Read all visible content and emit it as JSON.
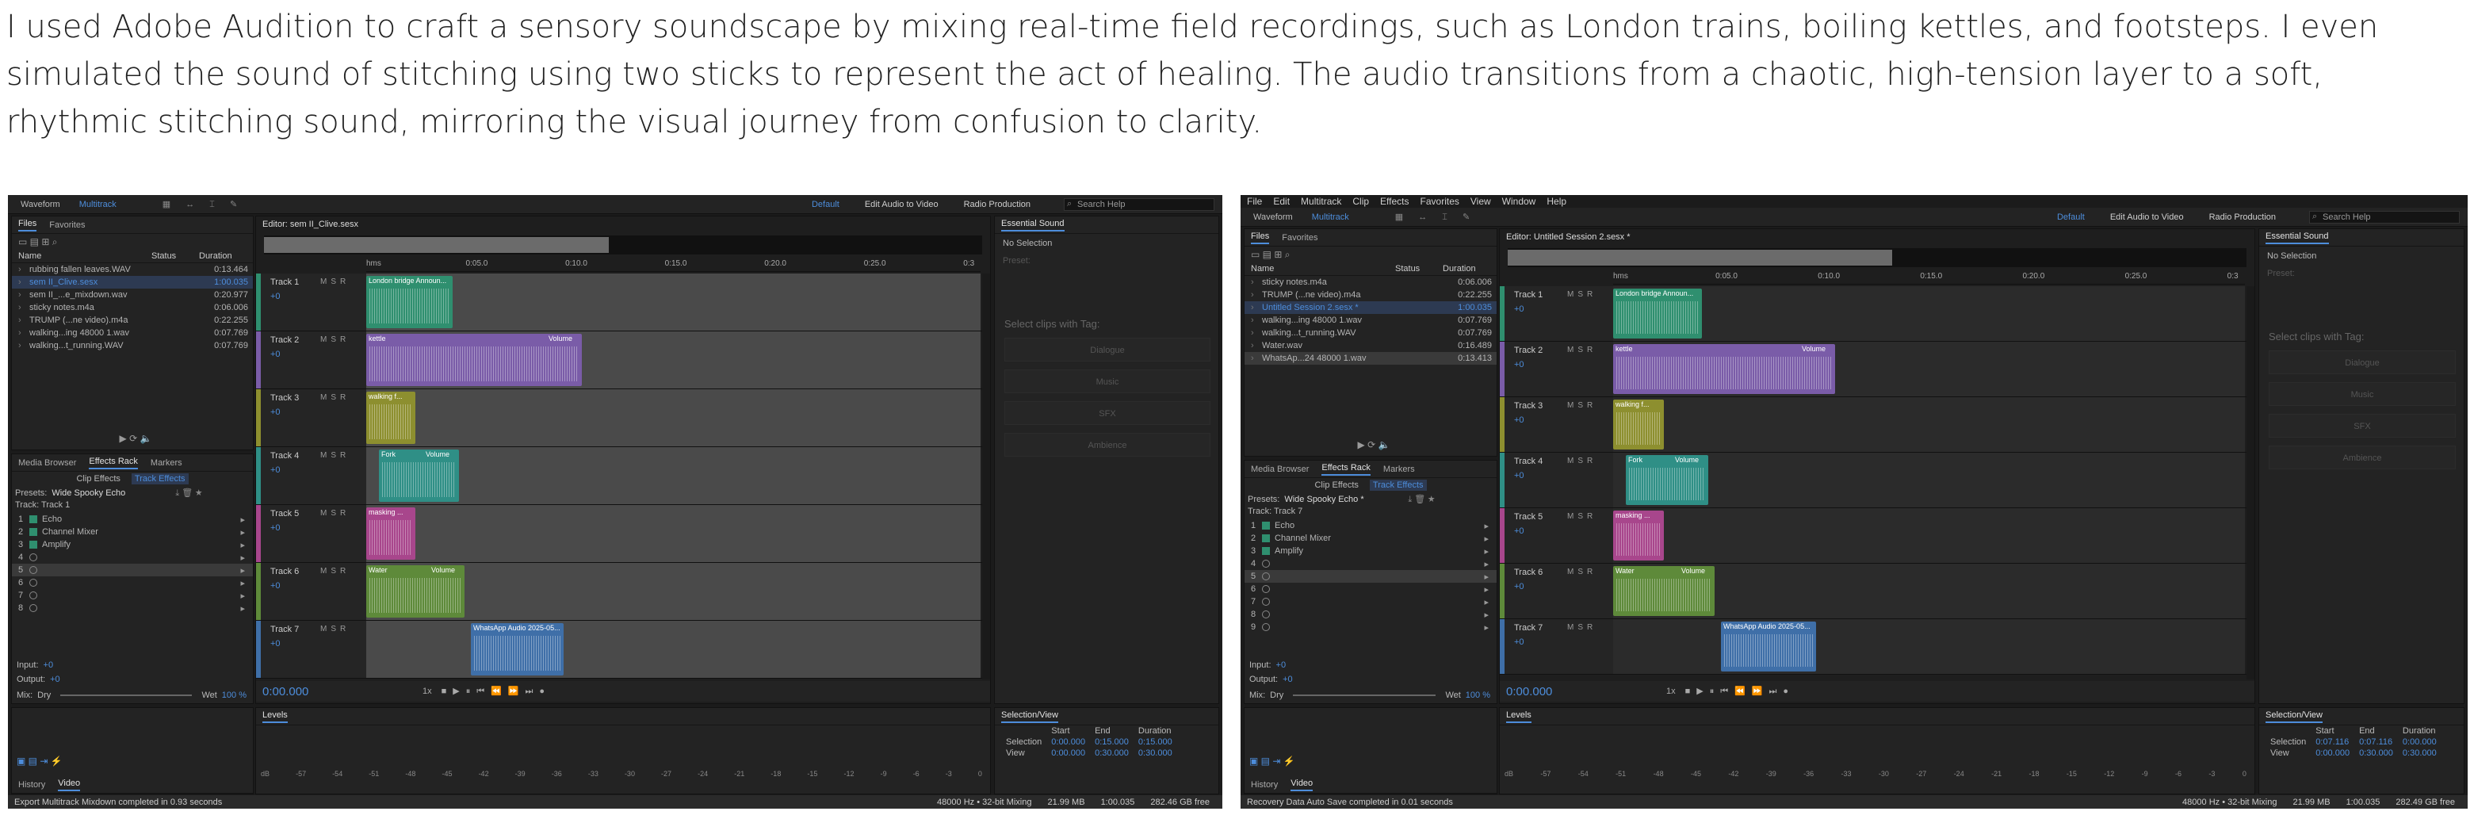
{
  "caption": "I used Adobe Audition to craft a sensory soundscape by mixing real-time field recordings, such as London trains, boiling kettles, and footsteps. I even simulated the sound of stitching using two sticks to represent the act of healing. The audio transitions from a chaotic, high-tension layer to a soft, rhythmic stitching sound, mirroring the visual journey from confusion to clarity.",
  "colors": {
    "accent": "#4d8ddb",
    "track1": "#2f8f6f",
    "track2": "#7a5ca8",
    "track3": "#8d8f2f",
    "track4": "#2f8f86",
    "track5": "#a8468c",
    "track6": "#5e8a3a",
    "track7": "#3f6fa8"
  },
  "left": {
    "menu": [],
    "toolbar": {
      "waveform": "Waveform",
      "multitrack": "Multitrack",
      "default": "Default",
      "edit_audio_video": "Edit Audio to Video",
      "radio_production": "Radio Production",
      "search": "Search Help"
    },
    "files": {
      "tab": "Files",
      "favorites": "Favorites",
      "col_name": "Name",
      "col_status": "Status",
      "col_duration": "Duration",
      "rows": [
        {
          "name": "rubbing fallen leaves.WAV",
          "dur": "0:13.464"
        },
        {
          "name": "sem II_Clive.sesx",
          "dur": "1:00.035"
        },
        {
          "name": "sem II_...e_mixdown.wav",
          "dur": "0:20.977"
        },
        {
          "name": "sticky notes.m4a",
          "dur": "0:06.006"
        },
        {
          "name": "TRUMP (...ne video).m4a",
          "dur": "0:22.255"
        },
        {
          "name": "walking...ing 48000 1.wav",
          "dur": "0:07.769"
        },
        {
          "name": "walking...t_running.WAV",
          "dur": "0:07.769"
        }
      ]
    },
    "effects": {
      "media_browser": "Media Browser",
      "effects_rack": "Effects Rack",
      "markers": "Markers",
      "clip_effects": "Clip Effects",
      "track_effects": "Track Effects",
      "presets_label": "Presets:",
      "presets_value": "Wide Spooky Echo",
      "track": "Track: Track 1",
      "items": [
        {
          "n": "1",
          "name": "Echo"
        },
        {
          "n": "2",
          "name": "Channel Mixer"
        },
        {
          "n": "3",
          "name": "Amplify"
        },
        {
          "n": "4",
          "name": ""
        },
        {
          "n": "5",
          "name": ""
        },
        {
          "n": "6",
          "name": ""
        },
        {
          "n": "7",
          "name": ""
        },
        {
          "n": "8",
          "name": ""
        }
      ],
      "input": "Input:",
      "output": "Output:",
      "in_val": "+0",
      "out_val": "+0",
      "mix": "Mix:",
      "dry": "Dry",
      "wet": "Wet",
      "wet_val": "100 %"
    },
    "editor": {
      "title": "Editor: sem II_Clive.sesx",
      "ruler": [
        "hms",
        "0:05.0",
        "0:10.0",
        "0:15.0",
        "0:20.0",
        "0:25.0",
        "0:3"
      ],
      "tracks": [
        {
          "name": "Track 1",
          "vol": "+0",
          "clip": "London bridge Announ...",
          "cv": ""
        },
        {
          "name": "Track 2",
          "vol": "+0",
          "clip": "kettle",
          "cv": "Volume"
        },
        {
          "name": "Track 3",
          "vol": "+0",
          "clip": "walking f...",
          "cv": ""
        },
        {
          "name": "Track 4",
          "vol": "+0",
          "clip": "Fork",
          "cv": "Volume"
        },
        {
          "name": "Track 5",
          "vol": "+0",
          "clip": "masking ...",
          "cv": ""
        },
        {
          "name": "Track 6",
          "vol": "+0",
          "clip": "Water",
          "cv": "Volume"
        },
        {
          "name": "Track 7",
          "vol": "+0",
          "clip": "WhatsApp Audio 2025-05...",
          "cv": ""
        }
      ],
      "time": "0:00.000",
      "speed": "1x"
    },
    "essential": {
      "title": "Essential Sound",
      "no_sel": "No Selection",
      "preset": "Preset:",
      "select_clips": "Select clips with Tag:",
      "dialogue": "Dialogue",
      "music": "Music",
      "sfx": "SFX",
      "ambience": "Ambience"
    },
    "levels": {
      "title": "Levels",
      "scale": [
        "dB",
        "-57",
        "-54",
        "-51",
        "-48",
        "-45",
        "-42",
        "-39",
        "-36",
        "-33",
        "-30",
        "-27",
        "-24",
        "-21",
        "-18",
        "-15",
        "-12",
        "-9",
        "-6",
        "-3",
        "0"
      ]
    },
    "history": "History",
    "video": "Video",
    "selview": {
      "title": "Selection/View",
      "start": "Start",
      "end": "End",
      "duration": "Duration",
      "selection": "Selection",
      "view": "View",
      "sel_start": "0:00.000",
      "sel_end": "0:15.000",
      "sel_dur": "0:15.000",
      "view_start": "0:00.000",
      "view_end": "0:30.000",
      "view_dur": "0:30.000"
    },
    "status": {
      "left": "Export Multitrack Mixdown completed in 0.93 seconds",
      "fmt": "48000 Hz • 32-bit Mixing",
      "mem": "21.99 MB",
      "len": "1:00.035",
      "free": "282.46 GB free"
    }
  },
  "right": {
    "menu": [
      "File",
      "Edit",
      "Multitrack",
      "Clip",
      "Effects",
      "Favorites",
      "View",
      "Window",
      "Help"
    ],
    "toolbar": {
      "waveform": "Waveform",
      "multitrack": "Multitrack",
      "default": "Default",
      "edit_audio_video": "Edit Audio to Video",
      "radio_production": "Radio Production",
      "search": "Search Help"
    },
    "files": {
      "tab": "Files",
      "favorites": "Favorites",
      "col_name": "Name",
      "col_status": "Status",
      "col_duration": "Duration",
      "rows": [
        {
          "name": "sticky notes.m4a",
          "dur": "0:06.006"
        },
        {
          "name": "TRUMP (...ne video).m4a",
          "dur": "0:22.255"
        },
        {
          "name": "Untitled Session 2.sesx *",
          "dur": "1:00.035"
        },
        {
          "name": "walking...ing 48000 1.wav",
          "dur": "0:07.769"
        },
        {
          "name": "walking...t_running.WAV",
          "dur": "0:07.769"
        },
        {
          "name": "Water.wav",
          "dur": "0:16.489"
        },
        {
          "name": "WhatsAp...24 48000 1.wav",
          "dur": "0:13.413"
        }
      ]
    },
    "effects": {
      "media_browser": "Media Browser",
      "effects_rack": "Effects Rack",
      "markers": "Markers",
      "clip_effects": "Clip Effects",
      "track_effects": "Track Effects",
      "presets_label": "Presets:",
      "presets_value": "Wide Spooky Echo *",
      "track": "Track: Track 7",
      "items": [
        {
          "n": "1",
          "name": "Echo"
        },
        {
          "n": "2",
          "name": "Channel Mixer"
        },
        {
          "n": "3",
          "name": "Amplify"
        },
        {
          "n": "4",
          "name": ""
        },
        {
          "n": "5",
          "name": ""
        },
        {
          "n": "6",
          "name": ""
        },
        {
          "n": "7",
          "name": ""
        },
        {
          "n": "8",
          "name": ""
        },
        {
          "n": "9",
          "name": ""
        }
      ],
      "input": "Input:",
      "output": "Output:",
      "in_val": "+0",
      "out_val": "+0",
      "mix": "Mix:",
      "dry": "Dry",
      "wet": "Wet",
      "wet_val": "100 %"
    },
    "editor": {
      "title": "Editor: Untitled Session 2.sesx *",
      "ruler": [
        "hms",
        "0:05.0",
        "0:10.0",
        "0:15.0",
        "0:20.0",
        "0:25.0",
        "0:3"
      ],
      "tracks": [
        {
          "name": "Track 1",
          "vol": "+0",
          "clip": "London bridge Announ...",
          "cv": ""
        },
        {
          "name": "Track 2",
          "vol": "+0",
          "clip": "kettle",
          "cv": "Volume"
        },
        {
          "name": "Track 3",
          "vol": "+0",
          "clip": "walking f...",
          "cv": ""
        },
        {
          "name": "Track 4",
          "vol": "+0",
          "clip": "Fork",
          "cv": "Volume"
        },
        {
          "name": "Track 5",
          "vol": "+0",
          "clip": "masking ...",
          "cv": ""
        },
        {
          "name": "Track 6",
          "vol": "+0",
          "clip": "Water",
          "cv": "Volume"
        },
        {
          "name": "Track 7",
          "vol": "+0",
          "clip": "WhatsApp Audio 2025-05...",
          "cv": ""
        }
      ],
      "time": "0:00.000",
      "speed": "1x"
    },
    "essential": {
      "title": "Essential Sound",
      "no_sel": "No Selection",
      "preset": "Preset:",
      "select_clips": "Select clips with Tag:",
      "dialogue": "Dialogue",
      "music": "Music",
      "sfx": "SFX",
      "ambience": "Ambience"
    },
    "levels": {
      "title": "Levels",
      "scale": [
        "dB",
        "-57",
        "-54",
        "-51",
        "-48",
        "-45",
        "-42",
        "-39",
        "-36",
        "-33",
        "-30",
        "-27",
        "-24",
        "-21",
        "-18",
        "-15",
        "-12",
        "-9",
        "-6",
        "-3",
        "0"
      ]
    },
    "history": "History",
    "video": "Video",
    "selview": {
      "title": "Selection/View",
      "start": "Start",
      "end": "End",
      "duration": "Duration",
      "selection": "Selection",
      "view": "View",
      "sel_start": "0:07.116",
      "sel_end": "0:07.116",
      "sel_dur": "0:00.000",
      "view_start": "0:00.000",
      "view_end": "0:30.000",
      "view_dur": "0:30.000"
    },
    "status": {
      "left": "Recovery Data Auto Save completed in 0.01 seconds",
      "fmt": "48000 Hz • 32-bit Mixing",
      "mem": "21.99 MB",
      "len": "1:00.035",
      "free": "282.49 GB free"
    }
  }
}
